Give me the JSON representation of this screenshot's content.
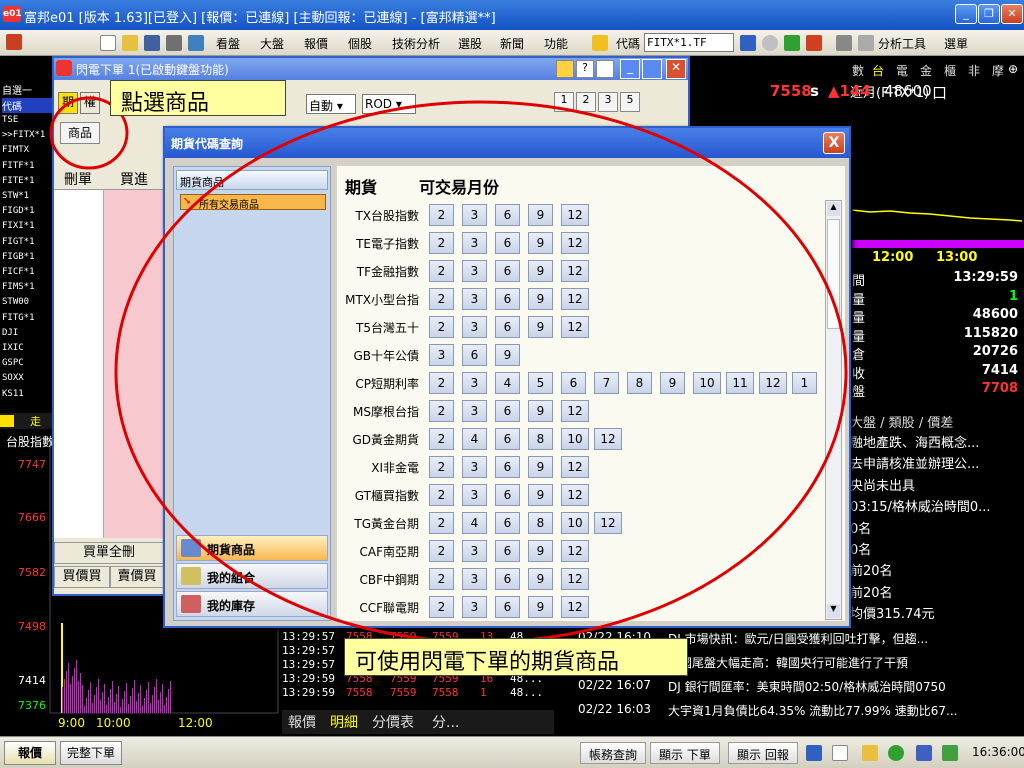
{
  "window": {
    "title": "富邦e01 [版本 1.63][已登入] [報價：已連線] [主動回報：已連線] - [富邦精選**]",
    "logo_text": "e01"
  },
  "toolbar": {
    "menus": [
      "看盤",
      "大盤",
      "報價",
      "個股",
      "技術分析",
      "選股",
      "新聞",
      "功能"
    ],
    "code_label": "代碼",
    "code_value": "FITX*1.TF",
    "right_menus": [
      "分析工具",
      "選單"
    ]
  },
  "left_panel": {
    "header": "自選一",
    "code_col": "代碼",
    "codes": [
      "TSE",
      ">>FITX*1",
      "FIMTX",
      "FITF*1",
      "FITE*1",
      "STW*1",
      "FIGD*1",
      "FIXI*1",
      "FIGT*1",
      "FIGB*1",
      "FICF*1",
      "FIMS*1",
      "STW00",
      "FITG*1",
      "DJI",
      "IXIC",
      "GSPC",
      "SOXX",
      "KS11"
    ]
  },
  "right_top": {
    "tabs": [
      "數",
      "台",
      "電",
      "金",
      "櫃",
      "非",
      "摩"
    ],
    "quote_label": "近月(FITX*1)",
    "price": "7558",
    "price_suffix": "s",
    "change": "▲144",
    "volume": "48600",
    "volume_suffix": "口",
    "time_axis": [
      "12:00",
      "13:00"
    ],
    "stats": [
      "間",
      "量",
      "量",
      "量",
      "倉",
      "收",
      "盤"
    ],
    "stat_values": [
      "13:29:59",
      "1",
      "48600",
      "115820",
      "20726",
      "7414",
      "7708"
    ]
  },
  "right_news": {
    "tabs": [
      "大盤",
      "類股",
      "價差"
    ],
    "items": [
      "融地產跌、海西概念...",
      "去申請核准並辦理公...",
      "央尚未出具",
      "03:15/格林威治時間0...",
      "0名",
      "0名",
      "前20名",
      "前20名",
      "均價315.74元"
    ]
  },
  "news_bottom": [
    {
      "date": "02/22 16:10",
      "text": "DJ 市場快訊：歐元/日圓受獲利回吐打擊，但趨..."
    },
    {
      "date": "02/22 16:07",
      "text": "韓國尾盤大幅走高：韓國央行可能進行了干預"
    },
    {
      "date": "02/22 16:07",
      "text": "DJ 銀行間匯率：美東時間02:50/格林威治時間0750"
    },
    {
      "date": "02/22 16:03",
      "text": "大宇資1月負債比64.35% 流動比77.99% 速動比67..."
    }
  ],
  "chart_bottom": {
    "tab": "走",
    "title": "台股指數",
    "price_labels": [
      "7747",
      "7666",
      "7582",
      "7498",
      "7414",
      "7376"
    ],
    "time_labels": [
      "9:00",
      "10:00",
      "12:00"
    ]
  },
  "quote_ticks": [
    {
      "time": "13:29:57",
      "a": "7558",
      "b": "7559",
      "c": "7559",
      "q": "13",
      "v": "48..."
    },
    {
      "time": "13:29:57",
      "a": "7558",
      "b": "7559",
      "c": "7558",
      "q": "5",
      "v": "48..."
    },
    {
      "time": "13:29:57",
      "a": "7558",
      "b": "7559",
      "c": "7559",
      "q": "1",
      "v": "48..."
    },
    {
      "time": "13:29:59",
      "a": "7558",
      "b": "7559",
      "c": "7559",
      "q": "16",
      "v": "48..."
    },
    {
      "time": "13:29:59",
      "a": "7558",
      "b": "7559",
      "c": "7558",
      "q": "1",
      "v": "48..."
    }
  ],
  "quote_tabs": [
    "報價",
    "明細",
    "分價表",
    "分..."
  ],
  "flash_order": {
    "title": "閃電下單 1(已啟動鍵盤功能)",
    "tabs": [
      "期",
      "權"
    ],
    "auto_select": "自動",
    "order_type": "ROD",
    "qty_buttons": [
      "1",
      "2",
      "3",
      "5"
    ],
    "product_label": "商品",
    "col_delete": "刪單",
    "col_buy": "買進",
    "buy_all": "買單全刪",
    "buy_price": "買價買",
    "sell_price": "賣價買"
  },
  "dialog": {
    "title": "期貨代碼查詢",
    "close": "X",
    "sidebar_header": "期貨商品",
    "sidebar_item": "所有交易商品",
    "sidebar_tabs": [
      "期貨商品",
      "我的組合",
      "我的庫存"
    ],
    "col_futures": "期貨",
    "col_months": "可交易月份",
    "rows": [
      {
        "name": "TX台股指數",
        "months": [
          "2",
          "3",
          "6",
          "9",
          "12"
        ]
      },
      {
        "name": "TE電子指數",
        "months": [
          "2",
          "3",
          "6",
          "9",
          "12"
        ]
      },
      {
        "name": "TF金融指數",
        "months": [
          "2",
          "3",
          "6",
          "9",
          "12"
        ]
      },
      {
        "name": "MTX小型台指",
        "months": [
          "2",
          "3",
          "6",
          "9",
          "12"
        ]
      },
      {
        "name": "T5台灣五十",
        "months": [
          "2",
          "3",
          "6",
          "9",
          "12"
        ]
      },
      {
        "name": "GB十年公債",
        "months": [
          "3",
          "6",
          "9"
        ]
      },
      {
        "name": "CP短期利率",
        "months": [
          "2",
          "3",
          "4",
          "5",
          "6",
          "7",
          "8",
          "9",
          "10",
          "11",
          "12",
          "1"
        ]
      },
      {
        "name": "MS摩根台指",
        "months": [
          "2",
          "3",
          "6",
          "9",
          "12"
        ]
      },
      {
        "name": "GD黃金期貨",
        "months": [
          "2",
          "4",
          "6",
          "8",
          "10",
          "12"
        ]
      },
      {
        "name": "XI非金電",
        "months": [
          "2",
          "3",
          "6",
          "9",
          "12"
        ]
      },
      {
        "name": "GT櫃買指數",
        "months": [
          "2",
          "3",
          "6",
          "9",
          "12"
        ]
      },
      {
        "name": "TG黃金台期",
        "months": [
          "2",
          "4",
          "6",
          "8",
          "10",
          "12"
        ]
      },
      {
        "name": "CAF南亞期",
        "months": [
          "2",
          "3",
          "6",
          "9",
          "12"
        ]
      },
      {
        "name": "CBF中鋼期",
        "months": [
          "2",
          "3",
          "6",
          "9",
          "12"
        ]
      },
      {
        "name": "CCF聯電期",
        "months": [
          "2",
          "3",
          "6",
          "9",
          "12"
        ]
      }
    ]
  },
  "callouts": {
    "top": "點選商品",
    "bottom": "可使用閃電下單的期貨商品"
  },
  "statusbar": {
    "left_tabs": [
      "報價",
      "完整下單"
    ],
    "right_buttons": [
      "帳務查詢",
      "顯示 下單",
      "顯示 回報"
    ],
    "clock": "16:36:00"
  },
  "colors": {
    "up_red": "#ff2020",
    "accent_yellow": "#ffff00",
    "annotation_red": "#e00000",
    "dialog_title": "#2658d0"
  }
}
